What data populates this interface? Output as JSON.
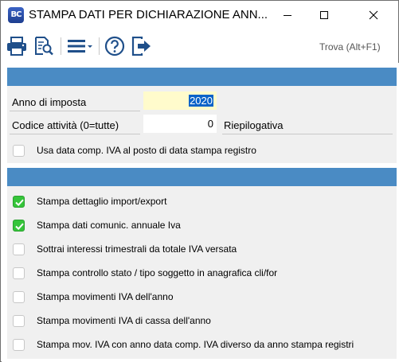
{
  "window": {
    "title": "STAMPA DATI PER DICHIARAZIONE ANN...",
    "app_icon_text": "BC"
  },
  "toolbar": {
    "search_label": "Trova (Alt+F1)",
    "icons": [
      "printer-icon",
      "preview-icon",
      "menu-icon",
      "help-icon",
      "exit-icon"
    ]
  },
  "form": {
    "year_label": "Anno di imposta",
    "year_value": "2020",
    "activity_label": "Codice attività (0=tutte)",
    "activity_value": "0",
    "summary_label": "Riepilogativa",
    "use_iva_date_label": "Usa data comp. IVA al posto di data stampa registro",
    "use_iva_date_checked": false
  },
  "options": [
    {
      "label": "Stampa dettaglio import/export",
      "checked": true
    },
    {
      "label": "Stampa dati comunic. annuale Iva",
      "checked": true
    },
    {
      "label": "Sottrai interessi trimestrali da totale IVA versata",
      "checked": false
    },
    {
      "label": "Stampa controllo stato / tipo soggetto in anagrafica cli/for",
      "checked": false
    },
    {
      "label": "Stampa movimenti IVA dell'anno",
      "checked": false
    },
    {
      "label": "Stampa movimenti IVA di cassa dell'anno",
      "checked": false
    },
    {
      "label": "Stampa mov. IVA con anno data comp. IVA diverso da anno stampa registri",
      "checked": false
    }
  ],
  "colors": {
    "section_header": "#4a8bc4",
    "check_on": "#35c53a",
    "year_bg": "#fffbcc",
    "selection": "#0a63c8"
  }
}
